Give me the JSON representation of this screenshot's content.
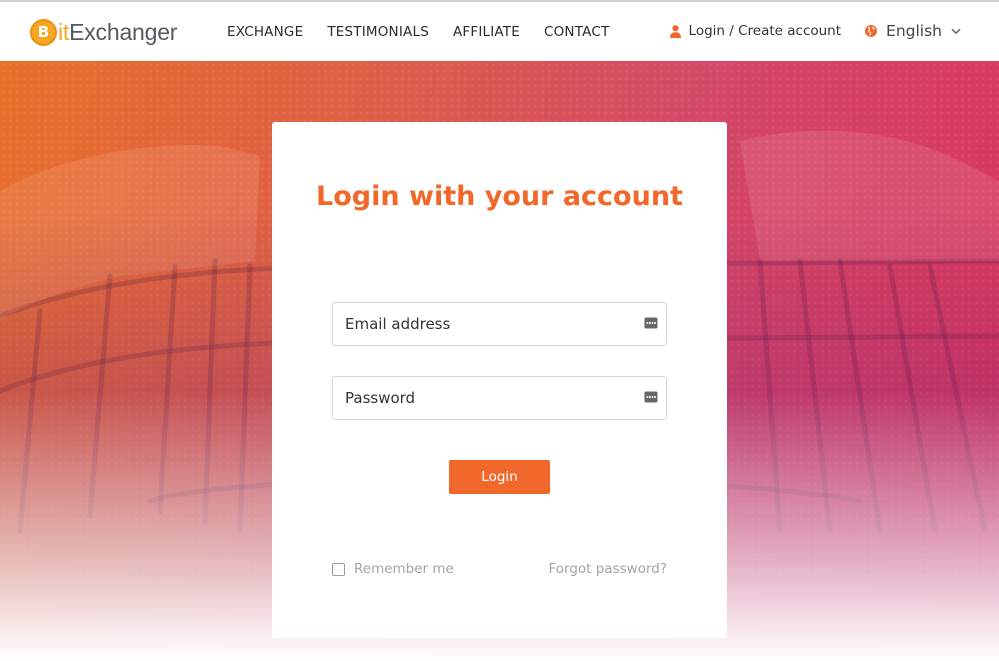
{
  "brand": {
    "logo_mark": "B",
    "logo_text_prefix": "it",
    "logo_text_main": "Exchanger"
  },
  "nav": {
    "items": [
      {
        "label": "EXCHANGE"
      },
      {
        "label": "TESTIMONIALS"
      },
      {
        "label": "AFFILIATE"
      },
      {
        "label": "CONTACT"
      }
    ]
  },
  "header": {
    "login_label": "Login / Create account",
    "language_label": "English",
    "user_icon": "user-icon",
    "language_icon": "globe-icon"
  },
  "login_card": {
    "title": "Login with your account",
    "email_placeholder": "Email address",
    "password_placeholder": "Password",
    "login_button": "Login",
    "remember_label": "Remember me",
    "remember_checked": false,
    "forgot_label": "Forgot password?"
  },
  "colors": {
    "accent": "#f1682a",
    "logo_gold": "#f5a623",
    "muted_text": "#a4a4a4"
  }
}
